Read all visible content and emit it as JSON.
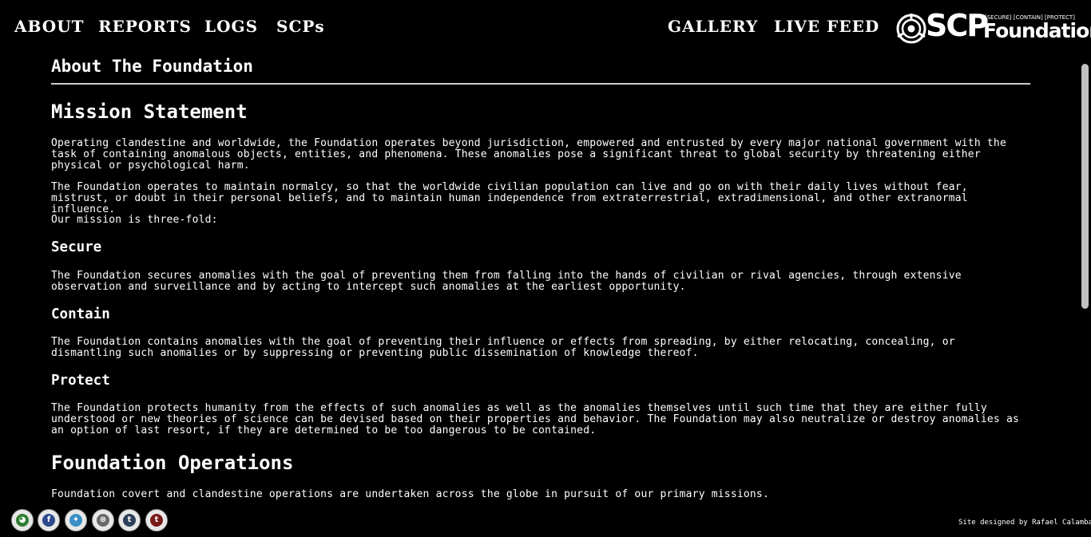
{
  "nav": {
    "about": "ABOUT",
    "reports": "REPORTS",
    "logs": "LOGS",
    "scps": "SCPs",
    "gallery": "GALLERY",
    "live_feed": "LIVE FEED"
  },
  "logo": {
    "scp": "SCP",
    "foundation": "Foundation",
    "tagline": "[SECURE] [CONTAIN] [PROTECT]"
  },
  "page": {
    "title": "About The Foundation",
    "mission_heading": "Mission Statement",
    "mission_p1": "Operating clandestine and worldwide, the Foundation operates beyond jurisdiction, empowered and entrusted by every major national government with the task of containing anomalous objects, entities, and phenomena. These anomalies pose a significant threat to global security by threatening either physical or psychological harm.",
    "mission_p2": "The Foundation operates to maintain normalcy, so that the worldwide civilian population can live and go on with their daily lives without fear, mistrust, or doubt in their personal beliefs, and to maintain human independence from extraterrestrial, extradimensional, and other extranormal influence.",
    "mission_p3": "Our mission is three-fold:",
    "secure_heading": "Secure",
    "secure_text": "The Foundation secures anomalies with the goal of preventing them from falling into the hands of civilian or rival agencies, through extensive observation and surveillance and by acting to intercept such anomalies at the earliest opportunity.",
    "contain_heading": "Contain",
    "contain_text": "The Foundation contains anomalies with the goal of preventing their influence or effects from spreading, by either relocating, concealing, or dismantling such anomalies or by suppressing or preventing public dissemination of knowledge thereof.",
    "protect_heading": "Protect",
    "protect_text": "The Foundation protects humanity from the effects of such anomalies as well as the anomalies themselves until such time that they are either fully understood or new theories of science can be devised based on their properties and behavior. The Foundation may also neutralize or destroy anomalies as an option of last resort, if they are determined to be too dangerous to be contained.",
    "operations_heading": "Foundation Operations",
    "operations_text": "Foundation covert and clandestine operations are undertaken across the globe in pursuit of our primary missions."
  },
  "footer": {
    "credit": "Site designed by Rafael Calamba",
    "social": [
      {
        "icon": "reddit-icon",
        "glyph": "◕",
        "color": "#2e7d32"
      },
      {
        "icon": "facebook-icon",
        "glyph": "f",
        "color": "#2c4a8c"
      },
      {
        "icon": "twitter-icon",
        "glyph": "✦",
        "color": "#3a8fc7"
      },
      {
        "icon": "scp-wiki-icon",
        "glyph": "⊛",
        "color": "#6a6a6a"
      },
      {
        "icon": "tumblr-icon",
        "glyph": "t",
        "color": "#2e3f5a"
      },
      {
        "icon": "tumblr-alt-icon",
        "glyph": "t",
        "color": "#7a1a1a"
      }
    ]
  }
}
